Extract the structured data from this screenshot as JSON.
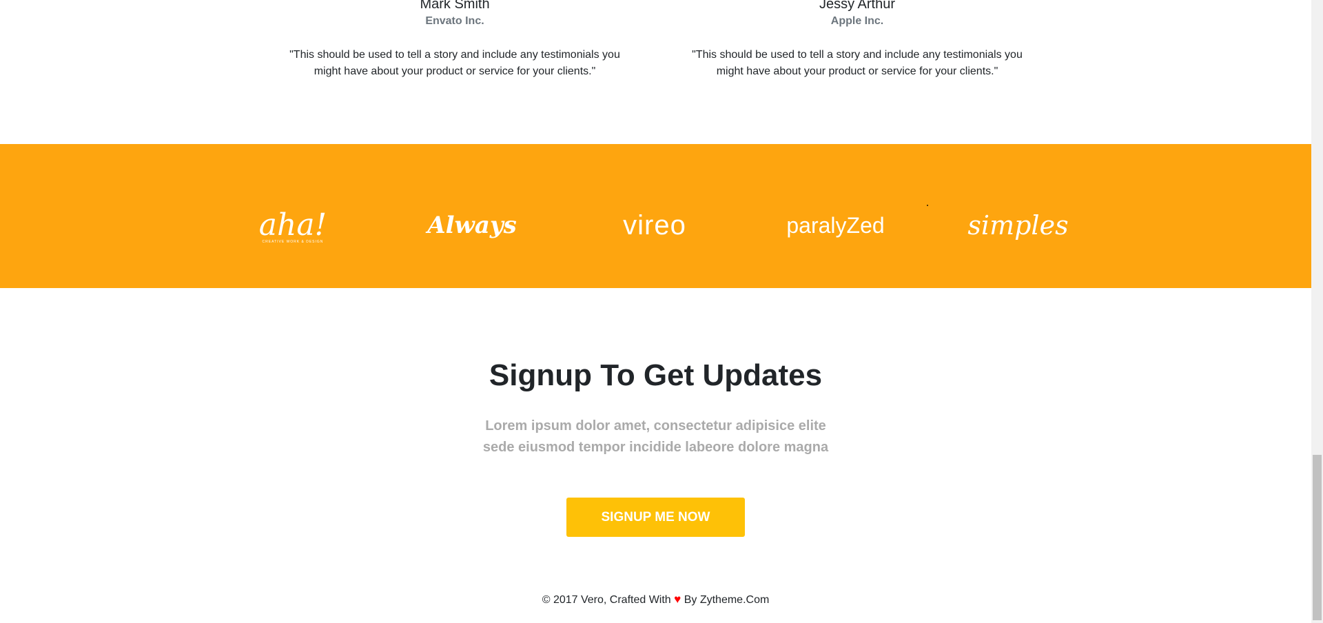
{
  "testimonials": [
    {
      "name": "Mark Smith",
      "company": "Envato Inc.",
      "quote": "\"This should be used to tell a story and include any testimonials you might have about your product or service for your clients.\""
    },
    {
      "name": "Jessy Arthur",
      "company": "Apple Inc.",
      "quote": "\"This should be used to tell a story and include any testimonials you might have about your product or service for your clients.\""
    }
  ],
  "brands": {
    "background_color": "#fea50f",
    "items": [
      {
        "logo_text": "aha!",
        "tagline": "CREATIVE WORK & DESIGN",
        "icon": "aha-logo"
      },
      {
        "logo_text": "Always",
        "icon": "always-logo"
      },
      {
        "logo_text": "vireo",
        "icon": "vireo-logo"
      },
      {
        "logo_text": "paralyZed",
        "icon": "paralyzed-logo"
      },
      {
        "logo_text": "simples",
        "icon": "simples-logo"
      }
    ]
  },
  "signup": {
    "title": "Signup To Get Updates",
    "subtitle_line1": "Lorem ipsum dolor amet, consectetur adipisice elite",
    "subtitle_line2": "sede eiusmod tempor incidide labeore dolore magna",
    "button_label": "SIGNUP ME NOW",
    "button_color": "#fec107"
  },
  "footer": {
    "text_before": "© 2017 Vero, Crafted With",
    "heart": "♥",
    "text_after": "By Zytheme.Com",
    "heart_color": "#ff0000"
  }
}
